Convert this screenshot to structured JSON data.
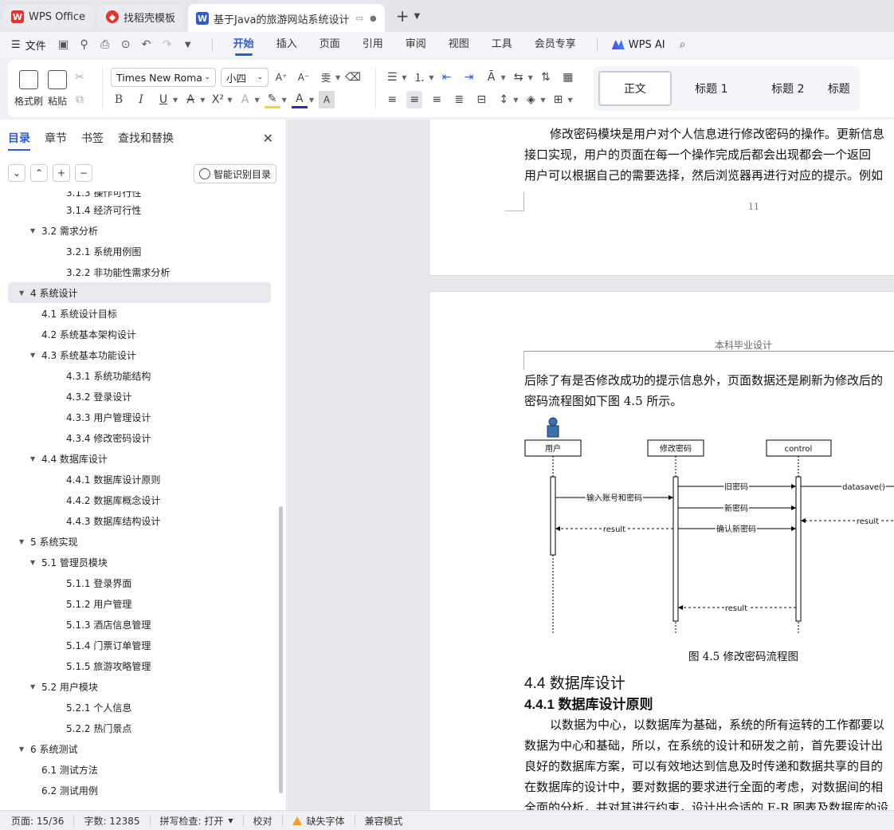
{
  "tabs": [
    {
      "label": "WPS Office",
      "icon": "wps-logo-icon",
      "color": "#e8332b"
    },
    {
      "label": "找稻壳模板",
      "icon": "docer-logo-icon",
      "color": "#e8332b"
    },
    {
      "label": "基于Java的旅游网站系统设计",
      "icon": "writer-logo-icon",
      "color": "#2d5bd3",
      "active": true
    }
  ],
  "menubar": {
    "file_label": "文件",
    "items": [
      "开始",
      "插入",
      "页面",
      "引用",
      "审阅",
      "视图",
      "工具",
      "会员专享"
    ],
    "active": "开始",
    "ai_label": "WPS AI"
  },
  "ribbon": {
    "format_painter": "格式刷",
    "paste": "粘贴",
    "font_name": "Times New Roma",
    "font_size": "小四",
    "styles": [
      "正文",
      "标题 1",
      "标题 2",
      "标题"
    ]
  },
  "sidebar": {
    "tabs": [
      "目录",
      "章节",
      "书签",
      "查找和替换"
    ],
    "smart_button": "智能识别目录",
    "toc": [
      {
        "label": "3.1.3 操作可行性",
        "level": 3
      },
      {
        "label": "3.1.4 经济可行性",
        "level": 3
      },
      {
        "label": "3.2 需求分析",
        "level": 2,
        "expanded": true
      },
      {
        "label": "3.2.1 系统用例图",
        "level": 3
      },
      {
        "label": "3.2.2 非功能性需求分析",
        "level": 3
      },
      {
        "label": "4 系统设计",
        "level": 1,
        "expanded": true,
        "selected": true
      },
      {
        "label": "4.1 系统设计目标",
        "level": 2
      },
      {
        "label": "4.2 系统基本架构设计",
        "level": 2
      },
      {
        "label": "4.3 系统基本功能设计",
        "level": 2,
        "expanded": true
      },
      {
        "label": "4.3.1 系统功能结构",
        "level": 3
      },
      {
        "label": "4.3.2 登录设计",
        "level": 3
      },
      {
        "label": "4.3.3 用户管理设计",
        "level": 3
      },
      {
        "label": "4.3.4 修改密码设计",
        "level": 3
      },
      {
        "label": "4.4 数据库设计",
        "level": 2,
        "expanded": true
      },
      {
        "label": "4.4.1 数据库设计原则",
        "level": 3
      },
      {
        "label": "4.4.2 数据库概念设计",
        "level": 3
      },
      {
        "label": "4.4.3 数据库结构设计",
        "level": 3
      },
      {
        "label": "5 系统实现",
        "level": 1,
        "expanded": true
      },
      {
        "label": "5.1 管理员模块",
        "level": 2,
        "expanded": true
      },
      {
        "label": "5.1.1 登录界面",
        "level": 3
      },
      {
        "label": "5.1.2 用户管理",
        "level": 3
      },
      {
        "label": "5.1.3 酒店信息管理",
        "level": 3
      },
      {
        "label": "5.1.4 门票订单管理",
        "level": 3
      },
      {
        "label": "5.1.5 旅游攻略管理",
        "level": 3
      },
      {
        "label": "5.2 用户模块",
        "level": 2,
        "expanded": true
      },
      {
        "label": "5.2.1 个人信息",
        "level": 3
      },
      {
        "label": "5.2.2 热门景点",
        "level": 3
      },
      {
        "label": "6 系统测试",
        "level": 1,
        "expanded": true
      },
      {
        "label": "6.1 测试方法",
        "level": 2
      },
      {
        "label": "6.2 测试用例",
        "level": 2
      }
    ]
  },
  "document": {
    "page1_lines": [
      "修改密码模块是用户对个人信息进行修改密码的操作。更新信息",
      "接口实现，用户的页面在每一个操作完成后都会出现都会一个返回",
      "用户可以根据自己的需要选择，然后浏览器再进行对应的提示。例如"
    ],
    "page1_number": "11",
    "page2_header": "本科毕业设计",
    "page2_lines": [
      "后除了有是否修改成功的提示信息外，页面数据还是刷新为修改后的",
      "密码流程图如下图 4.5 所示。"
    ],
    "diagram": {
      "lifelines": [
        "用户",
        "修改密码",
        "control"
      ],
      "messages": [
        "旧密码",
        "datasave()",
        "输入账号和密码",
        "新密码",
        "result",
        "result",
        "确认新密码",
        "result"
      ]
    },
    "figure_caption": "图 4.5  修改密码流程图",
    "heading2": "4.4  数据库设计",
    "heading3": "4.4.1  数据库设计原则",
    "body_lines": [
      "以数据为中心，以数据库为基础，系统的所有运转的工作都要以",
      "数据为中心和基础，所以，在系统的设计和研发之前，首先要设计出",
      "良好的数据库方案，可以有效地达到信息及时传递和数据共享的目的",
      "在数据库的设计中，要对数据的要求进行全面的考虑，对数据间的相",
      "全面的分析，并对其进行约束，设计出合适的 E-R 图表及数据库的设"
    ]
  },
  "status": {
    "page": "页面: 15/36",
    "words": "字数: 12385",
    "spell": "拼写检查: 打开",
    "proof": "校对",
    "missing_font": "缺失字体",
    "compat": "兼容模式"
  }
}
